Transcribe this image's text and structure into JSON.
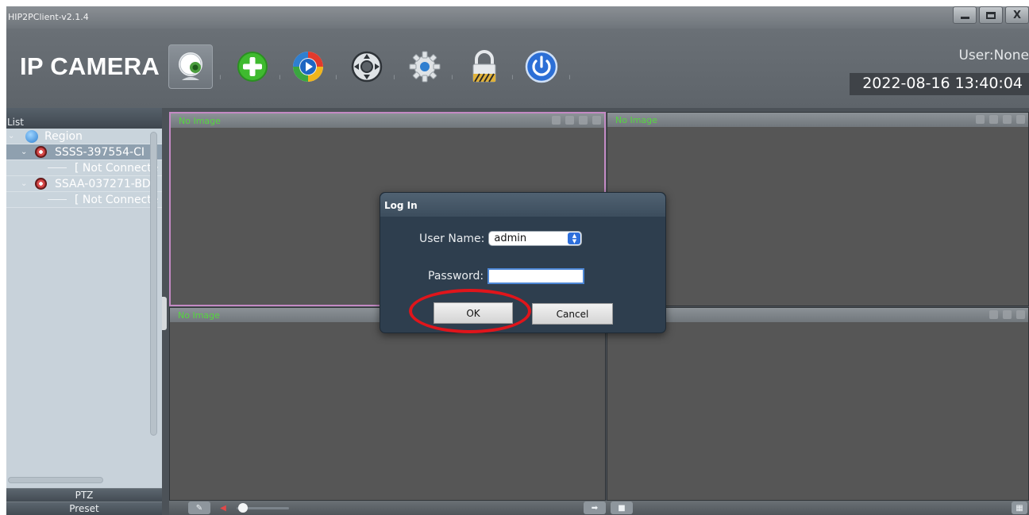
{
  "window": {
    "title": "HIP2PClient-v2.1.4",
    "controls": {
      "minimize": "",
      "maximize": "",
      "close": "X"
    }
  },
  "header": {
    "brand": "IP CAMERA",
    "user": "User:None",
    "datetime": "2022-08-16 13:40:04",
    "toolbar": [
      {
        "id": "preview",
        "icon": "webcam-icon",
        "active": true
      },
      {
        "id": "add-device",
        "icon": "add-icon"
      },
      {
        "id": "playback",
        "icon": "play-icon"
      },
      {
        "id": "ptz",
        "icon": "ptz-icon"
      },
      {
        "id": "settings",
        "icon": "gear-icon"
      },
      {
        "id": "lock",
        "icon": "lock-icon"
      },
      {
        "id": "exit",
        "icon": "power-icon"
      }
    ]
  },
  "sidebar": {
    "title": "List",
    "tree": {
      "root": "Region",
      "devices": [
        {
          "name": "SSSS-397554-CI",
          "status": "[ Not Connecte"
        },
        {
          "name": "SSAA-037271-BD",
          "status": "[ Not Connecte"
        }
      ]
    },
    "tabs": {
      "ptz": "PTZ",
      "preset": "Preset"
    }
  },
  "panes": [
    {
      "label": "No Image"
    },
    {
      "label": "No Image"
    },
    {
      "label": "No Image"
    },
    {
      "label": ""
    }
  ],
  "dialog": {
    "title": "Log In",
    "username_label": "User Name:",
    "username_value": "admin",
    "password_label": "Password:",
    "password_value": "",
    "ok": "OK",
    "cancel": "Cancel"
  },
  "colors": {
    "highlight_ring": "#e0151b",
    "no_image_text": "#56d63f",
    "active_pane_border": "#c48ac4"
  }
}
